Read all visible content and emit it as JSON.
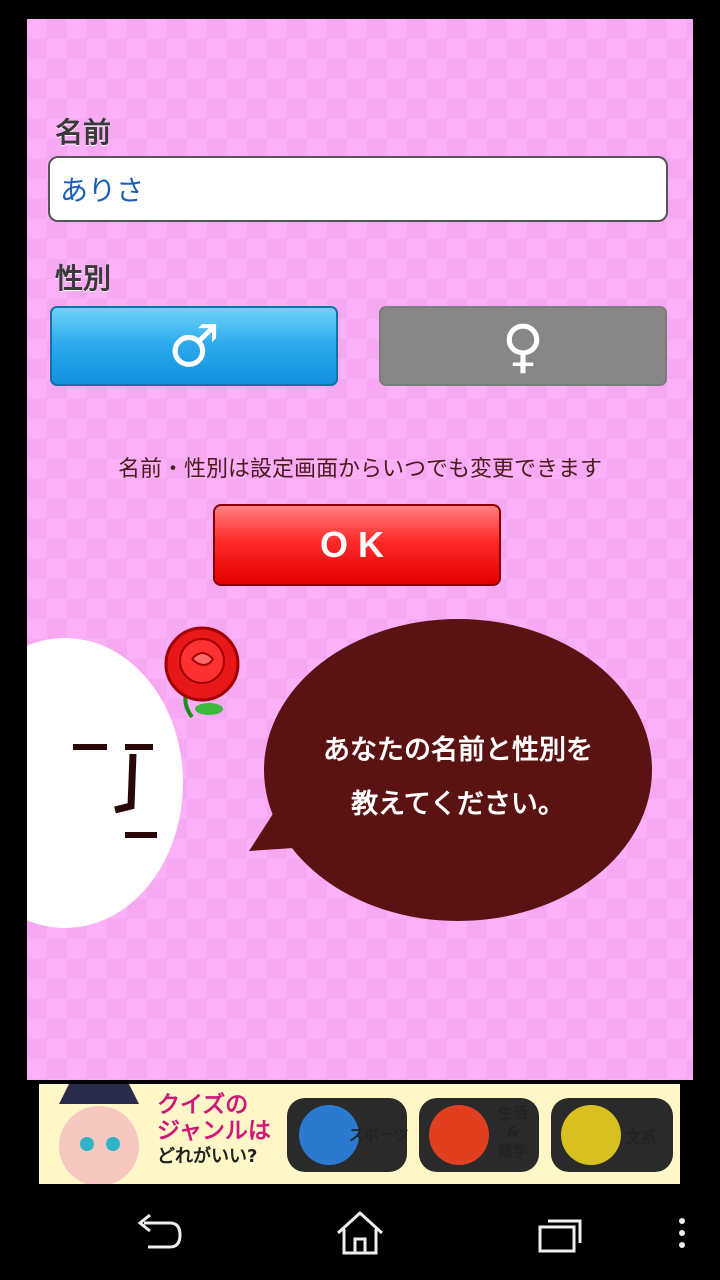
{
  "form": {
    "name_label": "名前",
    "name_value": "ありさ",
    "gender_label": "性別",
    "male_symbol": "♂",
    "female_symbol": "♀",
    "note": "名前・性別は設定画面からいつでも変更できます",
    "ok_label": "OK"
  },
  "speech": {
    "line1": "あなたの名前と性別を",
    "line2": "教えてください。"
  },
  "banner": {
    "headline1": "クイズの",
    "headline2": "ジャンルは",
    "headline3": "どれがいい?",
    "genres": [
      "スポーツ",
      "生活",
      "&",
      "雑学",
      "文系"
    ]
  },
  "colors": {
    "background": "#fbb0f7",
    "male_button": "#2aa8ec",
    "female_button": "#878787",
    "ok_button": "#ff2a2a",
    "bubble": "#5a1212"
  },
  "icons": [
    "male-icon",
    "female-icon",
    "rose-icon",
    "back-icon",
    "home-icon",
    "recents-icon",
    "menu-icon"
  ]
}
